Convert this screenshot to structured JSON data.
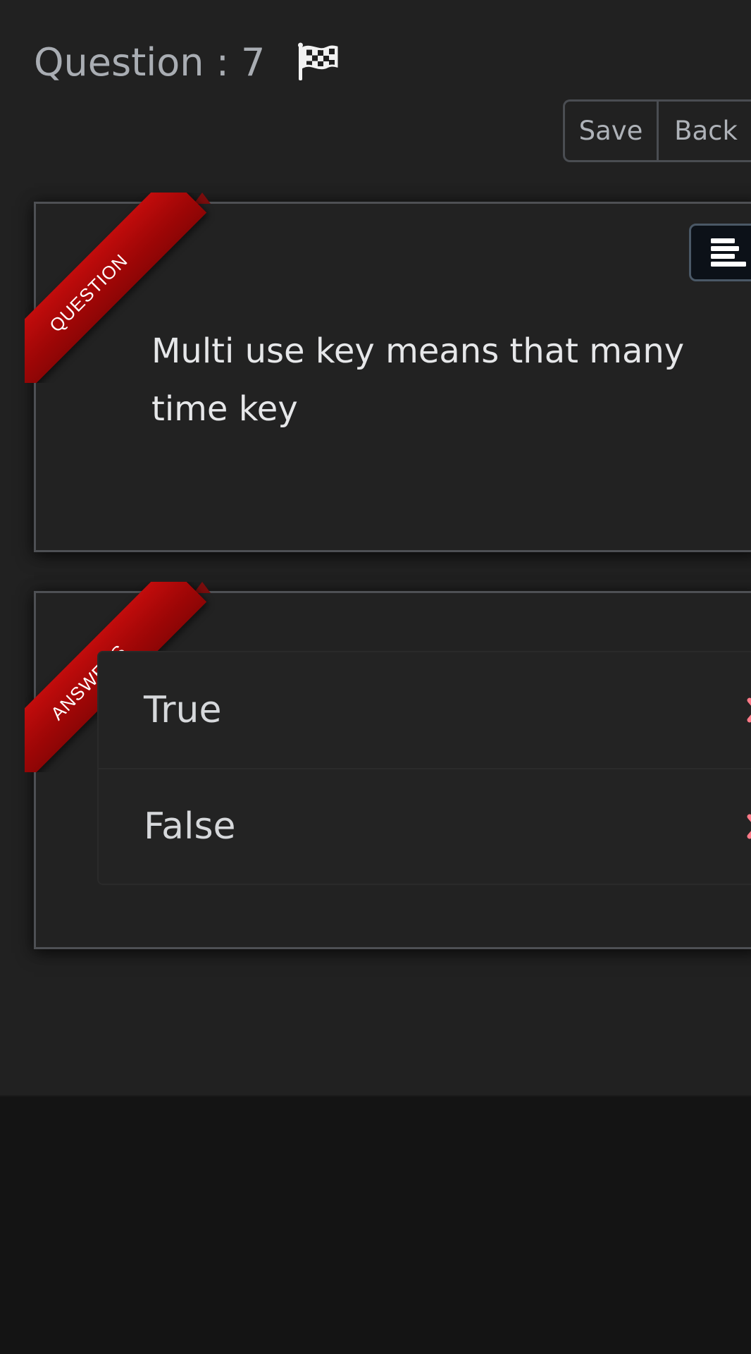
{
  "header": {
    "question_title": "Question : 7",
    "flag_icon": "checkered-flag-icon"
  },
  "toolbar": {
    "save_label": "Save",
    "back_label": "Back"
  },
  "question_card": {
    "ribbon_label": "QUESTION",
    "menu_icon": "align-left-icon",
    "question_text": "Multi use key means that many time key"
  },
  "answers_card": {
    "ribbon_label": "ANSWERS",
    "answers": [
      {
        "label": "True",
        "status_icon": "x-icon"
      },
      {
        "label": "False",
        "status_icon": "x-icon"
      }
    ]
  },
  "colors": {
    "background": "#212121",
    "card_border": "#4e5054",
    "ribbon_red": "#b00808",
    "wrong_mark": "#ff7a88",
    "text_primary": "#e6e7e9",
    "text_muted": "#a9adb3"
  }
}
